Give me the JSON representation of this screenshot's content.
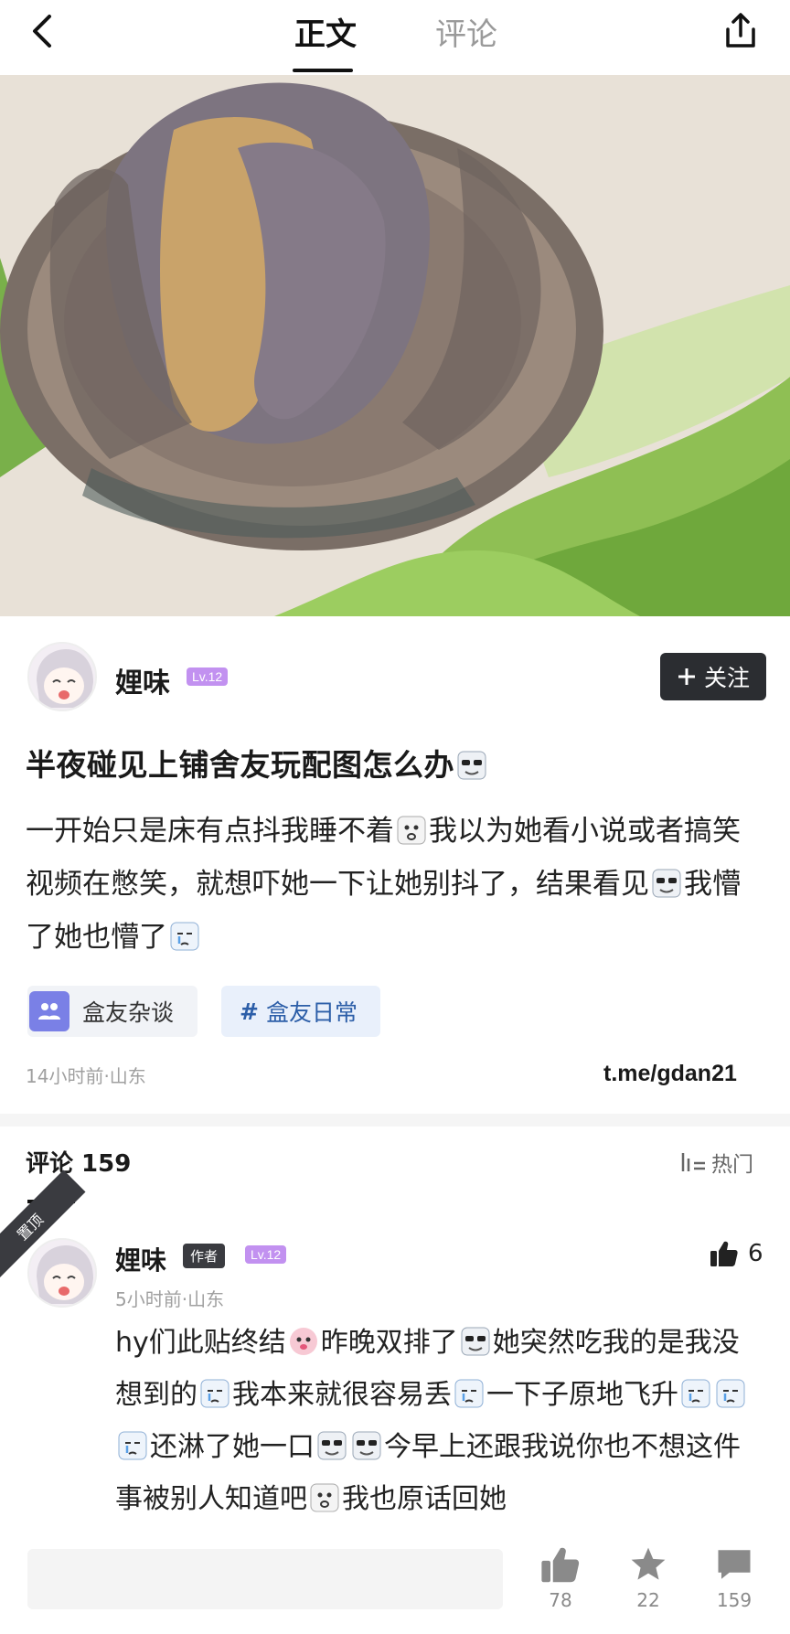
{
  "nav": {
    "tabs": [
      {
        "label": "正文",
        "active": true
      },
      {
        "label": "评论",
        "active": false
      }
    ],
    "back_icon": "chevron-left-icon",
    "share_icon": "share-upload-icon"
  },
  "hero": {
    "description_icon": "photo"
  },
  "author": {
    "name": "娌味",
    "level": "Lv.12",
    "follow_label": "关注"
  },
  "post": {
    "title": "半夜碰见上铺舍友玩配图怎么办",
    "body_parts": [
      "一开始只是床有点抖我睡不着",
      "我以为她看小说或者搞笑视频在憋笑，就想吓她一下让她别抖了，结果看见",
      "我懵了她也懵了"
    ],
    "chips": [
      {
        "label": "盒友杂谈"
      },
      {
        "label": "盒友日常",
        "prefix": "#"
      }
    ],
    "meta": "14小时前·山东",
    "link": "t.me/gdan21"
  },
  "comments": {
    "header": "评论 159",
    "sort_label": "热门",
    "pinned_label": "置顶",
    "items": [
      {
        "name": "娌味",
        "tag": "作者",
        "level": "Lv.12",
        "meta": "5小时前·山东",
        "likes": "6",
        "text_parts": [
          "hy们此贴终结",
          "昨晚双排了",
          "她突然吃我的是我没想到的",
          "我本来就很容易丢",
          "一下子原地飞升",
          "还淋了她一口",
          "今早上还跟我说你也不想这件事被别人知道吧",
          "我也原话回她"
        ]
      }
    ]
  },
  "bottom_bar": {
    "likes": "78",
    "favorites": "22",
    "comments": "159"
  },
  "colors": {
    "follow_bg": "#2b2d31",
    "level_badge": "#c291f0",
    "topic_chip_text": "#2c5ea8",
    "meta_gray": "#a0a0a0"
  }
}
